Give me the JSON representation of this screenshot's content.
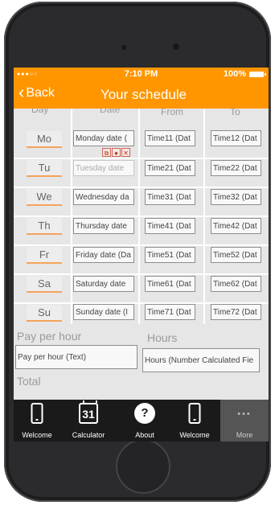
{
  "status": {
    "signal": "●●●○○",
    "time": "7:10 PM",
    "battery": "100%"
  },
  "nav": {
    "back_label": "Back",
    "title": "Your schedule"
  },
  "table": {
    "headers": {
      "day": "Day",
      "date": "Date",
      "from": "From",
      "to": "To"
    },
    "rows": [
      {
        "day": "Mo",
        "date": "Monday date (",
        "from": "Time11 (Dat",
        "to": "Time12 (Dat"
      },
      {
        "day": "Tu",
        "date": "Tuesday date",
        "from": "Time21 (Dat",
        "to": "Time22 (Dat"
      },
      {
        "day": "We",
        "date": "Wednesday da",
        "from": "Time31 (Dat",
        "to": "Time32 (Dat"
      },
      {
        "day": "Th",
        "date": "Thursday date",
        "from": "Time41 (Dat",
        "to": "Time42 (Dat"
      },
      {
        "day": "Fr",
        "date": "Friday date (Da",
        "from": "Time51 (Dat",
        "to": "Time52 (Dat"
      },
      {
        "day": "Sa",
        "date": "Saturday date",
        "from": "Time61 (Dat",
        "to": "Time62 (Dat"
      },
      {
        "day": "Su",
        "date": "Sunday date (I",
        "from": "Time71 (Dat",
        "to": "Time72 (Dat"
      }
    ]
  },
  "pay": {
    "pay_label": "Pay per hour",
    "hours_label": "Hours",
    "pay_value": "Pay per hour (Text)",
    "hours_value": "Hours (Number Calculated Fie",
    "total_label": "Total"
  },
  "tabs": [
    {
      "label": "Welcome",
      "icon": "phone-icon"
    },
    {
      "label": "Calculator",
      "icon": "calendar-icon",
      "icon_text": "31"
    },
    {
      "label": "About",
      "icon": "help-icon",
      "icon_text": "?"
    },
    {
      "label": "Welcome",
      "icon": "phone-icon"
    },
    {
      "label": "More",
      "icon": "more-icon",
      "icon_text": "•••"
    }
  ],
  "colors": {
    "accent": "#ff9600",
    "tabbar": "#1a1a1a"
  }
}
